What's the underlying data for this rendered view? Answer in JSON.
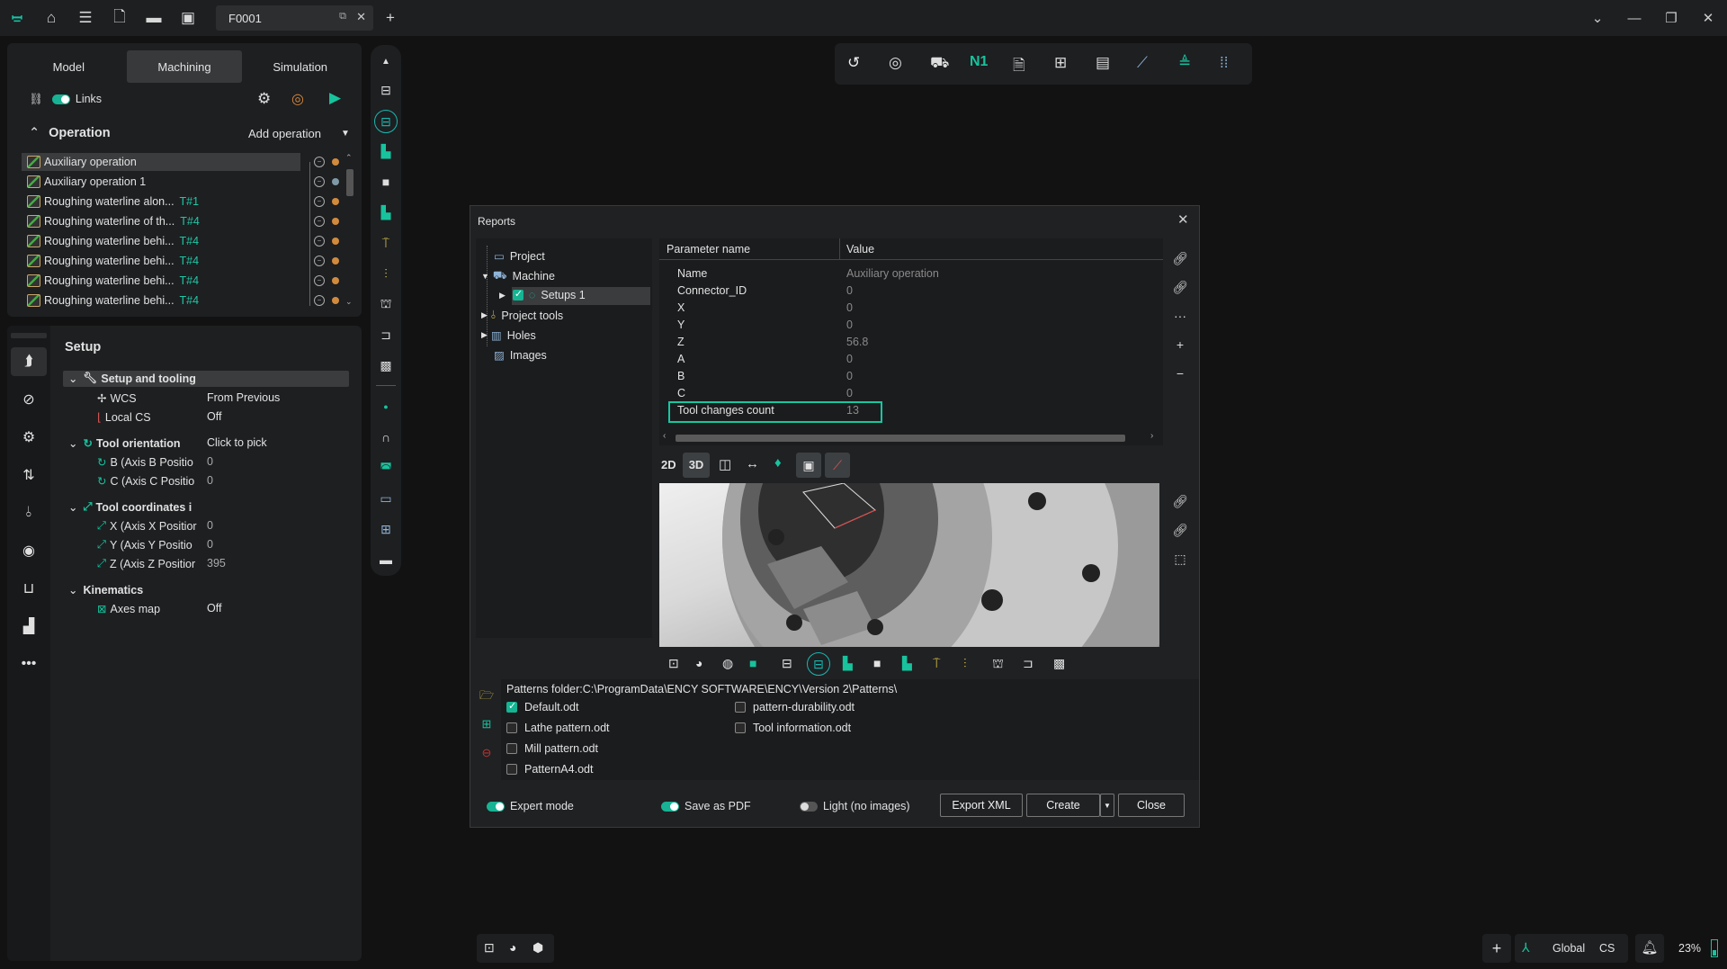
{
  "topbar": {
    "file_tab": "F0001"
  },
  "left_tabs": [
    "Model",
    "Machining",
    "Simulation"
  ],
  "links_label": "Links",
  "operation": {
    "title": "Operation",
    "add_label": "Add operation",
    "items": [
      {
        "name": "Auxiliary operation",
        "tag": "",
        "dot": "#d28a3c"
      },
      {
        "name": "Auxiliary operation 1",
        "tag": "",
        "dot": "#7f9aa6"
      },
      {
        "name": "Roughing waterline alon...",
        "tag": "T#1",
        "dot": "#d28a3c"
      },
      {
        "name": "Roughing waterline of th...",
        "tag": "T#4",
        "dot": "#d28a3c"
      },
      {
        "name": "Roughing waterline behi...",
        "tag": "T#4",
        "dot": "#d28a3c"
      },
      {
        "name": "Roughing waterline behi...",
        "tag": "T#4",
        "dot": "#d28a3c"
      },
      {
        "name": "Roughing waterline behi...",
        "tag": "T#4",
        "dot": "#d28a3c"
      },
      {
        "name": "Roughing waterline behi...",
        "tag": "T#4",
        "dot": "#d28a3c"
      }
    ]
  },
  "setup": {
    "title": "Setup",
    "sections": {
      "setup_tooling": {
        "label": "Setup and tooling",
        "rows": [
          {
            "k": "WCS",
            "v": "From Previous"
          },
          {
            "k": "Local CS",
            "v": "Off"
          }
        ]
      },
      "tool_orientation": {
        "label": "Tool orientation",
        "value": "Click to pick",
        "rows": [
          {
            "k": "B (Axis B Positio",
            "v": "0"
          },
          {
            "k": "C (Axis C Positio",
            "v": "0"
          }
        ]
      },
      "tool_coordinates": {
        "label": "Tool coordinates i",
        "rows": [
          {
            "k": "X (Axis X Positior",
            "v": "0"
          },
          {
            "k": "Y (Axis Y Positio",
            "v": "0"
          },
          {
            "k": "Z (Axis Z Positior",
            "v": "395"
          }
        ]
      },
      "kinematics": {
        "label": "Kinematics",
        "rows": [
          {
            "k": "Axes map",
            "v": "Off"
          }
        ]
      }
    }
  },
  "dialog": {
    "title": "Reports",
    "tree": [
      {
        "label": "Project"
      },
      {
        "label": "Machine"
      },
      {
        "label": "Setups 1"
      },
      {
        "label": "Project tools"
      },
      {
        "label": "Holes"
      },
      {
        "label": "Images"
      }
    ],
    "table_headers": [
      "Parameter name",
      "Value"
    ],
    "params": [
      {
        "k": "Name",
        "v": "Auxiliary operation"
      },
      {
        "k": "Connector_ID",
        "v": "0"
      },
      {
        "k": "X",
        "v": "0"
      },
      {
        "k": "Y",
        "v": "0"
      },
      {
        "k": "Z",
        "v": "56.8"
      },
      {
        "k": "A",
        "v": "0"
      },
      {
        "k": "B",
        "v": "0"
      },
      {
        "k": "C",
        "v": "0"
      },
      {
        "k": "Tool changes count",
        "v": "13"
      }
    ],
    "view_2d": "2D",
    "view_3d": "3D",
    "patterns_folder": "Patterns folder:C:\\ProgramData\\ENCY SOFTWARE\\ENCY\\Version 2\\Patterns\\",
    "patterns_left": [
      {
        "label": "Default.odt",
        "checked": true
      },
      {
        "label": "Lathe pattern.odt",
        "checked": false
      },
      {
        "label": "Mill pattern.odt",
        "checked": false
      },
      {
        "label": "PatternA4.odt",
        "checked": false
      }
    ],
    "patterns_right": [
      {
        "label": "pattern-durability.odt",
        "checked": false
      },
      {
        "label": "Tool information.odt",
        "checked": false
      }
    ],
    "expert_mode": "Expert mode",
    "save_pdf": "Save as PDF",
    "light": "Light (no images)",
    "export_xml": "Export XML",
    "create": "Create",
    "close": "Close"
  },
  "status": {
    "global": "Global",
    "cs": "CS",
    "zoom": "23%"
  }
}
